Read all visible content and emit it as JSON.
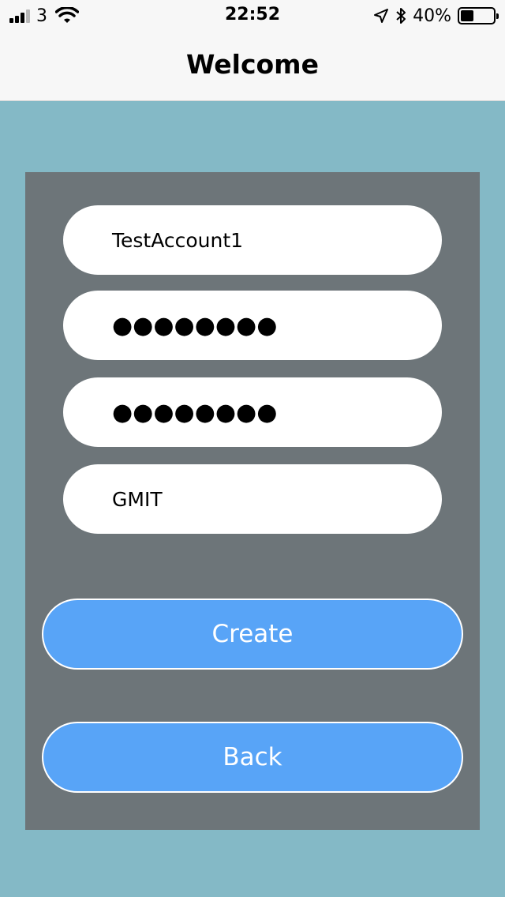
{
  "status_bar": {
    "carrier": "3",
    "time": "22:52",
    "battery_text": "40%",
    "battery_level": 0.4
  },
  "nav": {
    "title": "Welcome"
  },
  "form": {
    "username": "TestAccount1",
    "password": "●●●●●●●●",
    "confirm_password": "●●●●●●●●",
    "institution": "GMIT"
  },
  "buttons": {
    "create": "Create",
    "back": "Back"
  },
  "colors": {
    "background": "#84b9c6",
    "panel": "#6d7579",
    "button": "#58a4f7"
  }
}
